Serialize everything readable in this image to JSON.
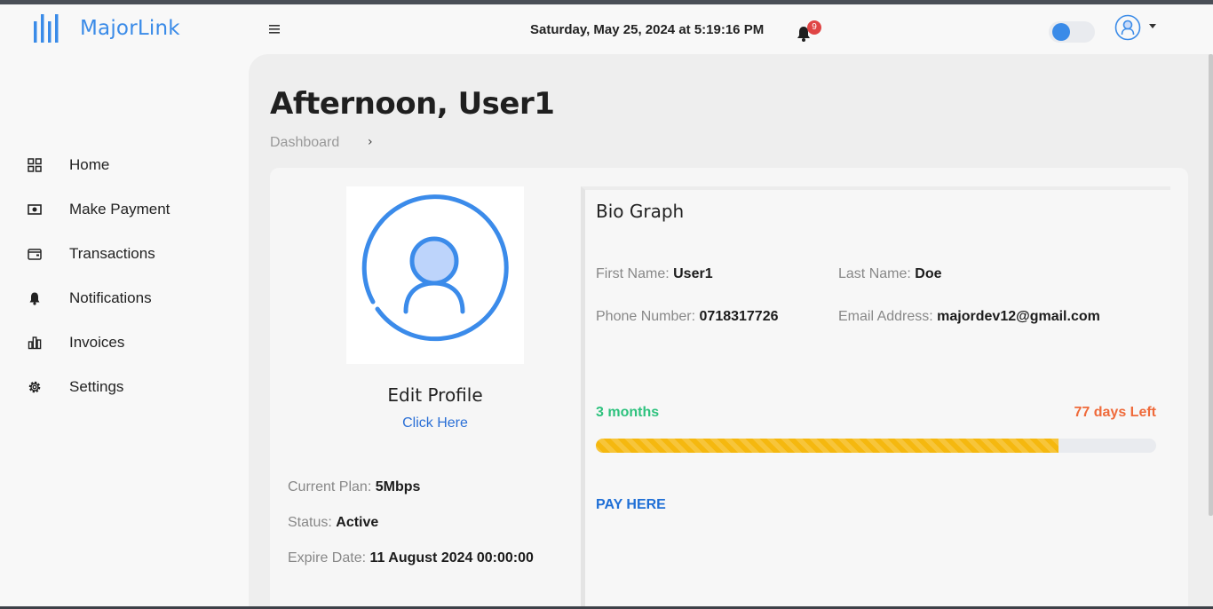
{
  "brand": {
    "name": "MajorLink",
    "color": "#3a8be8"
  },
  "header": {
    "datetime": "Saturday, May 25, 2024 at 5:19:16 PM",
    "notification_count": "9",
    "menu_icon": "hamburger-icon",
    "theme_toggle": "off"
  },
  "sidebar": {
    "items": [
      {
        "label": "Home",
        "icon": "grid-icon"
      },
      {
        "label": "Make Payment",
        "icon": "cash-icon"
      },
      {
        "label": "Transactions",
        "icon": "wallet-icon"
      },
      {
        "label": "Notifications",
        "icon": "bell-icon"
      },
      {
        "label": "Invoices",
        "icon": "bar-chart-icon"
      },
      {
        "label": "Settings",
        "icon": "gear-icon"
      }
    ]
  },
  "main": {
    "greeting": "Afternoon, User1",
    "breadcrumb": "Dashboard",
    "profile": {
      "edit_title": "Edit Profile",
      "edit_link": "Click Here",
      "plan_label": "Current Plan:",
      "plan_value": "5Mbps",
      "status_label": "Status:",
      "status_value": "Active",
      "expire_label": "Expire Date:",
      "expire_value": "11 August 2024 00:00:00"
    },
    "bio": {
      "title": "Bio Graph",
      "first_name_label": "First Name:",
      "first_name": "User1",
      "last_name_label": "Last Name:",
      "last_name": "Doe",
      "phone_label": "Phone Number:",
      "phone": "0718317726",
      "email_label": "Email Address:",
      "email": "majordev12@gmail.com"
    },
    "subscription": {
      "duration": "3 months",
      "days_left": "77 days Left",
      "progress_fraction": 0.825,
      "progress_color": "#f5b80f",
      "pay_link": "PAY HERE"
    }
  }
}
